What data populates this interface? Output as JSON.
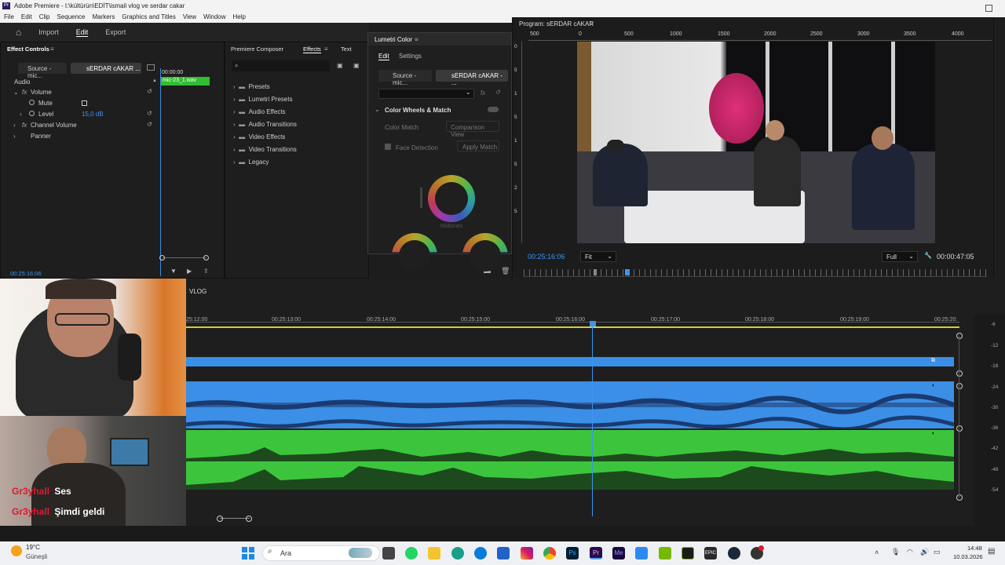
{
  "window": {
    "title": "Adobe Premiere - I:\\kültürün\\EDİT\\ismail vlog ve serdar cakar",
    "app_icon": "Pr"
  },
  "menu": [
    "File",
    "Edit",
    "Clip",
    "Sequence",
    "Markers",
    "Graphics and Titles",
    "View",
    "Window",
    "Help"
  ],
  "workspace": {
    "tabs": [
      "Import",
      "Edit",
      "Export"
    ],
    "active": "Edit"
  },
  "effect_controls": {
    "tab": "Effect Controls",
    "source_tab": "Source - mic...",
    "sequence_tab": "sERDAR cAKAR ...",
    "timecode_start": "00:00:00",
    "clip_label": "mic-23_1.wav",
    "section": "Audio",
    "rows": [
      {
        "label": "Volume",
        "fx": "fx"
      },
      {
        "label": "Mute"
      },
      {
        "label": "Level",
        "value": "15,0 dB"
      },
      {
        "label": "Channel Volume",
        "fx": "fx"
      },
      {
        "label": "Panner"
      }
    ],
    "timecode": "00:25:16:06"
  },
  "effects_panel": {
    "tabs": [
      "Premiere Composer",
      "Effects",
      "Text"
    ],
    "active": "Effects",
    "folders": [
      "Presets",
      "Lumetri Presets",
      "Audio Effects",
      "Audio Transitions",
      "Video Effects",
      "Video Transitions",
      "Legacy"
    ]
  },
  "lumetri": {
    "title": "Lumetri Color",
    "tabs": [
      "Edit",
      "Settings"
    ],
    "source_tab": "Source - mic...",
    "seq_tab": "sERDAR cAKAR - ...",
    "section": "Color Wheels & Match",
    "color_match": "Color Match",
    "comparison": "Comparison View",
    "face_detection": "Face Detection",
    "apply_match": "Apply Match",
    "midtones": "Midtones"
  },
  "program": {
    "title": "Program: sERDAR cAKAR",
    "ruler": [
      "500",
      "0",
      "500",
      "1000",
      "1500",
      "2000",
      "2500",
      "3000",
      "3500",
      "4000"
    ],
    "vruler": [
      "0",
      "5",
      "1",
      "5",
      "1",
      "5",
      "2",
      "5"
    ],
    "timecode": "00:25:16:06",
    "fit": "Fit",
    "full": "Full",
    "duration": "00:00:47:05"
  },
  "timeline": {
    "sequence": "VLOG",
    "ticks": [
      "25:12:00",
      "00:25:13:00",
      "00:25:14:00",
      "00:25:15:00",
      "00:25:16:00",
      "00:25:17:00",
      "00:25:18:00",
      "00:25:19:00",
      "00:25:20:"
    ],
    "db_scale": [
      "-6",
      "-12",
      "-18",
      "-24",
      "-30",
      "-36",
      "-42",
      "-48",
      "-54"
    ]
  },
  "webcam": {
    "chat": [
      {
        "user": "Gr3yhall",
        "msg": "Ses"
      },
      {
        "user": "Gr3yhall",
        "msg": "Şimdi geldi"
      }
    ]
  },
  "taskbar": {
    "weather_temp": "19°C",
    "weather_desc": "Güneşli",
    "search": "Ara",
    "time": "14:48",
    "date": "10.03.2026"
  },
  "colors": {
    "accent": "#2d8ceb",
    "audio_blue": "#3b8fe6",
    "audio_green": "#3cc53c",
    "chat_user": "#e0182d"
  }
}
